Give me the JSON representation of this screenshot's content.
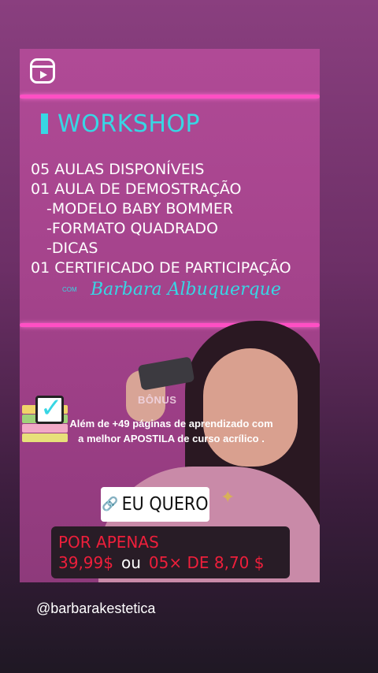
{
  "story": {
    "title": "WORKSHOP",
    "lines": [
      {
        "text": "05 AULAS DISPONÍVEIS",
        "indent": false
      },
      {
        "text": "01 AULA DE DEMOSTRAÇÃO",
        "indent": false
      },
      {
        "text": "-MODELO BABY BOMMER",
        "indent": true
      },
      {
        "text": "-FORMATO QUADRADO",
        "indent": true
      },
      {
        "text": "-DICAS",
        "indent": true
      },
      {
        "text": "01 CERTIFICADO DE PARTICIPAÇÃO",
        "indent": false
      }
    ],
    "com": "COM",
    "signature": "Barbara Albuquerque",
    "bonus_label": "BÔNUS",
    "bonus_text": "Além de +49 páginas de aprendizado com a melhor APOSTILA de curso acrílico .",
    "cta_label": "EU QUERO",
    "price_line1": "POR APENAS",
    "price_value": "39,99$",
    "price_or": "ou",
    "price_installments": "05× DE 8,70 $"
  },
  "account": {
    "handle": "@barbarakestetica"
  },
  "colors": {
    "accent_cyan": "#38d6e4",
    "frame_pink": "#ff4fc4",
    "price_red": "#ee1f3b",
    "card_bg": "#a4438b"
  },
  "icons": [
    "reels-icon",
    "link-icon",
    "checkbox-icon"
  ]
}
